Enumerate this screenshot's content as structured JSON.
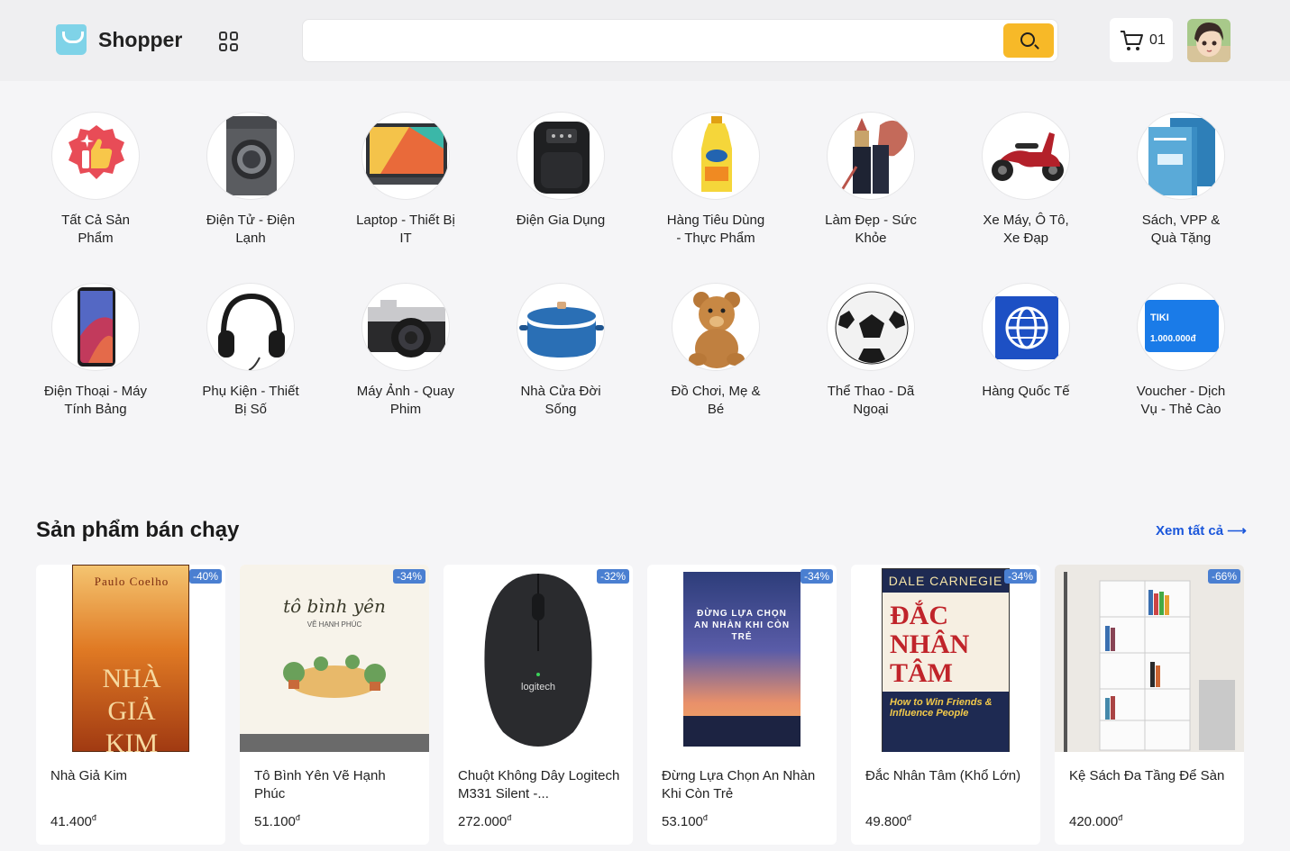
{
  "header": {
    "logo_text": "Shopper",
    "search_placeholder": "",
    "cart_count": "01"
  },
  "categories": [
    {
      "label": "Tất Cả Sản Phẩm",
      "icon": "thumbs-up-badge-icon"
    },
    {
      "label": "Điện Tử - Điện Lạnh",
      "icon": "washing-machine-icon"
    },
    {
      "label": "Laptop - Thiết Bị IT",
      "icon": "laptop-icon"
    },
    {
      "label": "Điện Gia Dụng",
      "icon": "air-fryer-icon"
    },
    {
      "label": "Hàng Tiêu Dùng - Thực Phẩm",
      "icon": "cooking-oil-icon"
    },
    {
      "label": "Làm Đẹp - Sức Khỏe",
      "icon": "lipstick-icon"
    },
    {
      "label": "Xe Máy, Ô Tô, Xe Đạp",
      "icon": "motorbike-icon"
    },
    {
      "label": "Sách, VPP & Quà Tặng",
      "icon": "books-icon"
    },
    {
      "label": "Điện Thoại - Máy Tính Bảng",
      "icon": "smartphone-icon"
    },
    {
      "label": "Phụ Kiện - Thiết Bị Số",
      "icon": "headphones-icon"
    },
    {
      "label": "Máy Ảnh - Quay Phim",
      "icon": "camera-icon"
    },
    {
      "label": "Nhà Cửa Đời Sống",
      "icon": "cooking-pot-icon"
    },
    {
      "label": "Đồ Chơi, Mẹ & Bé",
      "icon": "teddy-bear-icon"
    },
    {
      "label": "Thể Thao - Dã Ngoại",
      "icon": "soccer-ball-icon"
    },
    {
      "label": "Hàng Quốc Tế",
      "icon": "globe-icon"
    },
    {
      "label": "Voucher - Dịch Vụ - Thẻ Cào",
      "icon": "voucher-card-icon"
    }
  ],
  "voucher_card": {
    "brand": "TIKI",
    "amount": "1.000.000đ"
  },
  "bestsellers": {
    "title": "Sản phẩm bán chạy",
    "see_all": "Xem tất cả",
    "products": [
      {
        "name": "Nhà Giả Kim",
        "price": "41.400",
        "currency": "đ",
        "discount": "-40%",
        "cover_author": "Paulo Coelho",
        "cover_title": "NHÀ GIẢ KIM"
      },
      {
        "name": "Tô Bình Yên Vẽ Hạnh Phúc",
        "price": "51.100",
        "currency": "đ",
        "discount": "-34%",
        "cover_title": "tô bình yên",
        "cover_subtitle": "VẼ HẠNH PHÚC"
      },
      {
        "name": "Chuột Không Dây Logitech M331 Silent -...",
        "price": "272.000",
        "currency": "đ",
        "discount": "-32%",
        "cover_title": "logitech"
      },
      {
        "name": "Đừng Lựa Chọn An Nhàn Khi Còn Trẻ",
        "price": "53.100",
        "currency": "đ",
        "discount": "-34%",
        "cover_title": "ĐỪNG LỰA CHỌN AN NHÀN KHI CÒN TRẺ"
      },
      {
        "name": "Đắc Nhân Tâm (Khổ Lớn)",
        "price": "49.800",
        "currency": "đ",
        "discount": "-34%",
        "cover_author": "DALE CARNEGIE",
        "cover_title": "ĐẮC NHÂN TÂM",
        "cover_subtitle": "How to Win Friends & Influence People"
      },
      {
        "name": "Kệ Sách Đa Tầng Để Sàn",
        "price": "420.000",
        "currency": "đ",
        "discount": "-66%"
      }
    ]
  }
}
